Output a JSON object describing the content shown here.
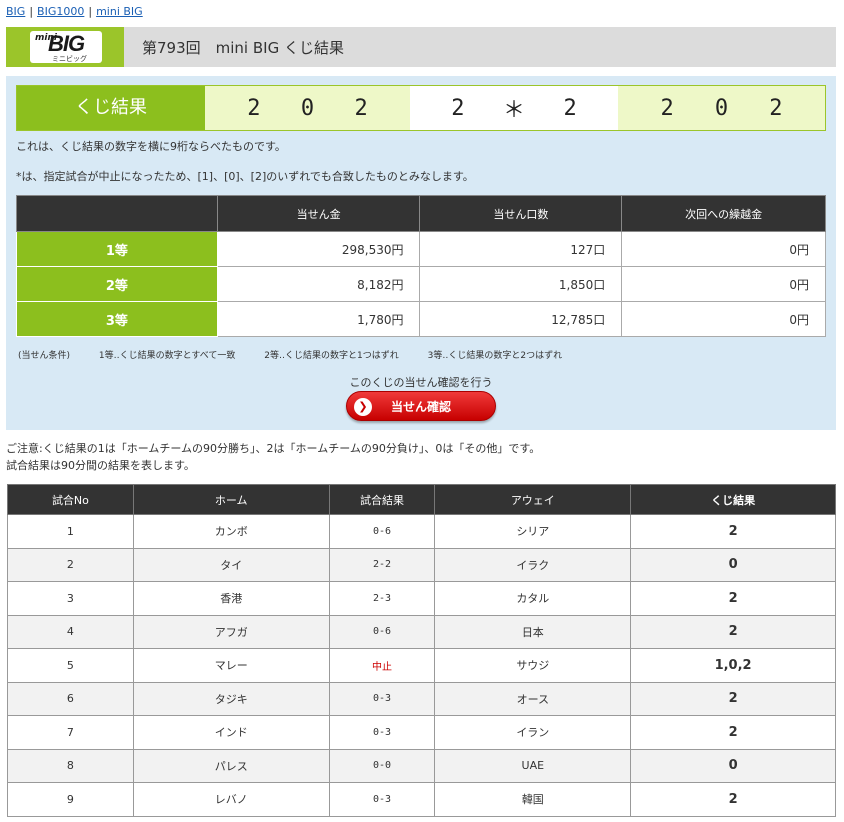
{
  "nav": [
    {
      "label": "BIG"
    },
    {
      "label": "BIG1000"
    },
    {
      "label": "mini BIG"
    }
  ],
  "logo": {
    "mini": "mini",
    "big": "BIG",
    "sub": "ミニビッグ"
  },
  "header": {
    "title": "第793回　mini BIG くじ結果"
  },
  "result": {
    "label": "くじ結果",
    "group1": [
      "2",
      "0",
      "2"
    ],
    "group2": [
      "2",
      "＊",
      "2"
    ],
    "group3": [
      "2",
      "0",
      "2"
    ]
  },
  "notes": {
    "line1": "これは、くじ結果の数字を横に9桁ならべたものです。",
    "line2": "*は、指定試合が中止になったため、[1]、[0]、[2]のいずれでも合致したものとみなします。"
  },
  "prize_table": {
    "headers": [
      "",
      "当せん金",
      "当せん口数",
      "次回への繰越金"
    ],
    "rows": [
      {
        "rank": "1等",
        "amount": "298,530円",
        "count": "127口",
        "carry": "0円"
      },
      {
        "rank": "2等",
        "amount": "8,182円",
        "count": "1,850口",
        "carry": "0円"
      },
      {
        "rank": "3等",
        "amount": "1,780円",
        "count": "12,785口",
        "carry": "0円"
      }
    ]
  },
  "conditions": {
    "label": "(当せん条件)",
    "c1": "1等‥くじ結果の数字とすべて一致",
    "c2": "2等‥くじ結果の数字と1つはずれ",
    "c3": "3等‥くじ結果の数字と2つはずれ"
  },
  "confirm": {
    "label": "このくじの当せん確認を行う",
    "button": "当せん確認"
  },
  "caution": {
    "line1": "ご注意:くじ結果の1は「ホームチームの90分勝ち」、2は「ホームチームの90分負け」、0は「その他」です。",
    "line2": "試合結果は90分間の結果を表します。"
  },
  "matches": {
    "headers": [
      "試合No",
      "ホーム",
      "試合結果",
      "アウェイ",
      "くじ結果"
    ],
    "rows": [
      {
        "no": "1",
        "home": "カンボ",
        "score": "0-6",
        "away": "シリア",
        "result": "2"
      },
      {
        "no": "2",
        "home": "タイ",
        "score": "2-2",
        "away": "イラク",
        "result": "0"
      },
      {
        "no": "3",
        "home": "香港",
        "score": "2-3",
        "away": "カタル",
        "result": "2"
      },
      {
        "no": "4",
        "home": "アフガ",
        "score": "0-6",
        "away": "日本",
        "result": "2"
      },
      {
        "no": "5",
        "home": "マレー",
        "score": "中止",
        "away": "サウジ",
        "result": "1,0,2"
      },
      {
        "no": "6",
        "home": "タジキ",
        "score": "0-3",
        "away": "オース",
        "result": "2"
      },
      {
        "no": "7",
        "home": "インド",
        "score": "0-3",
        "away": "イラン",
        "result": "2"
      },
      {
        "no": "8",
        "home": "パレス",
        "score": "0-0",
        "away": "UAE",
        "result": "0"
      },
      {
        "no": "9",
        "home": "レバノ",
        "score": "0-3",
        "away": "韓国",
        "result": "2"
      }
    ]
  },
  "colors": {
    "accent_green": "#8cbf1e",
    "stopped_red": "#cc0000",
    "header_dark": "#333333"
  }
}
